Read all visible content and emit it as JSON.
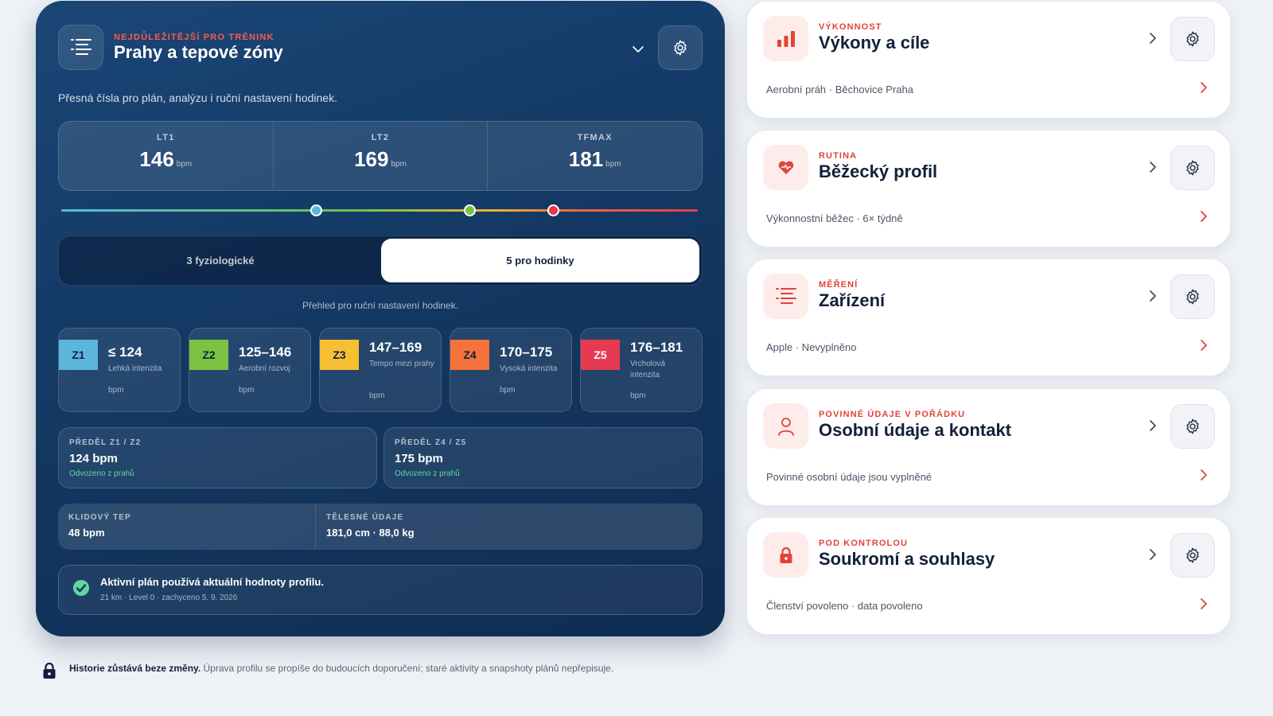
{
  "panel": {
    "eyebrow": "NEJDŮLEŽITĚJŠÍ PRO TRÉNINK",
    "title": "Prahy a tepové zóny",
    "subtitle": "Přesná čísla pro plán, analýzu i ruční nastavení hodinek.",
    "icons": {
      "header": "list-icon",
      "collapse": "chevron-down-icon",
      "settings": "gear-icon"
    }
  },
  "thresholds": [
    {
      "label": "LT1",
      "value": "146",
      "unit": "bpm"
    },
    {
      "label": "LT2",
      "value": "169",
      "unit": "bpm"
    },
    {
      "label": "TFMAX",
      "value": "181",
      "unit": "bpm"
    }
  ],
  "segmented": {
    "options": [
      "3 fyziologické",
      "5 pro hodinky"
    ],
    "selected": "5 pro hodinky"
  },
  "zone_hint": "Přehled pro ruční nastavení hodinek.",
  "zones": [
    {
      "badge": "Z1",
      "range": "≤ 124",
      "desc": "Lehká intenzita",
      "unit": "bpm",
      "color": "#5cb6dc"
    },
    {
      "badge": "Z2",
      "range": "125–146",
      "desc": "Aerobní rozvoj",
      "unit": "bpm",
      "color": "#7cc242"
    },
    {
      "badge": "Z3",
      "range": "147–169",
      "desc": "Tempo mezi prahy",
      "unit": "bpm",
      "color": "#f6c032"
    },
    {
      "badge": "Z4",
      "range": "170–175",
      "desc": "Vysoká intenzita",
      "unit": "bpm",
      "color": "#f5733a"
    },
    {
      "badge": "Z5",
      "range": "176–181",
      "desc": "Vrcholová intenzita",
      "unit": "bpm",
      "color": "#e63a52"
    }
  ],
  "boundaries": [
    {
      "label": "PŘEDĚL Z1 / Z2",
      "value": "124 bpm",
      "note": "Odvozeno z prahů"
    },
    {
      "label": "PŘEDĚL Z4 / Z5",
      "value": "175 bpm",
      "note": "Odvozeno z prahů"
    }
  ],
  "info": [
    {
      "label": "KLIDOVÝ TEP",
      "value": "48 bpm"
    },
    {
      "label": "TĚLESNÉ ÚDAJE",
      "value": "181,0 cm · 88,0 kg"
    }
  ],
  "plan": {
    "title": "Aktivní plán používá aktuální hodnoty profilu.",
    "sub": "21 km · Level 0 · zachyceno 5. 9. 2026",
    "icon": "check-circle-icon"
  },
  "footer": {
    "bold": "Historie zůstává beze změny.",
    "text": " Úprava profilu se propíše do budoucích doporučení; staré aktivity a snapshoty plánů nepřepisuje.",
    "icon": "lock-icon"
  },
  "cards": [
    {
      "eyebrow": "VÝKONNOST",
      "title": "Výkony a cíle",
      "sub": "Aerobní práh · Běchovice Praha",
      "icon": "bar-chart-icon"
    },
    {
      "eyebrow": "RUTINA",
      "title": "Běžecký profil",
      "sub": "Výkonnostní běžec · 6× týdně",
      "icon": "heart-icon"
    },
    {
      "eyebrow": "MĚŘENÍ",
      "title": "Zařízení",
      "sub": "Apple · Nevyplněno",
      "icon": "list-icon"
    },
    {
      "eyebrow": "POVINNÉ ÚDAJE V POŘÁDKU",
      "title": "Osobní údaje a kontakt",
      "sub": "Povinné osobní údaje jsou vyplněné",
      "icon": "user-icon"
    },
    {
      "eyebrow": "POD KONTROLOU",
      "title": "Soukromí a souhlasy",
      "sub": "Členství povoleno · data povoleno",
      "icon": "lock-icon"
    }
  ],
  "colors": {
    "accent": "#e2433a",
    "panel": "#123660",
    "success": "#5fd6a3"
  }
}
